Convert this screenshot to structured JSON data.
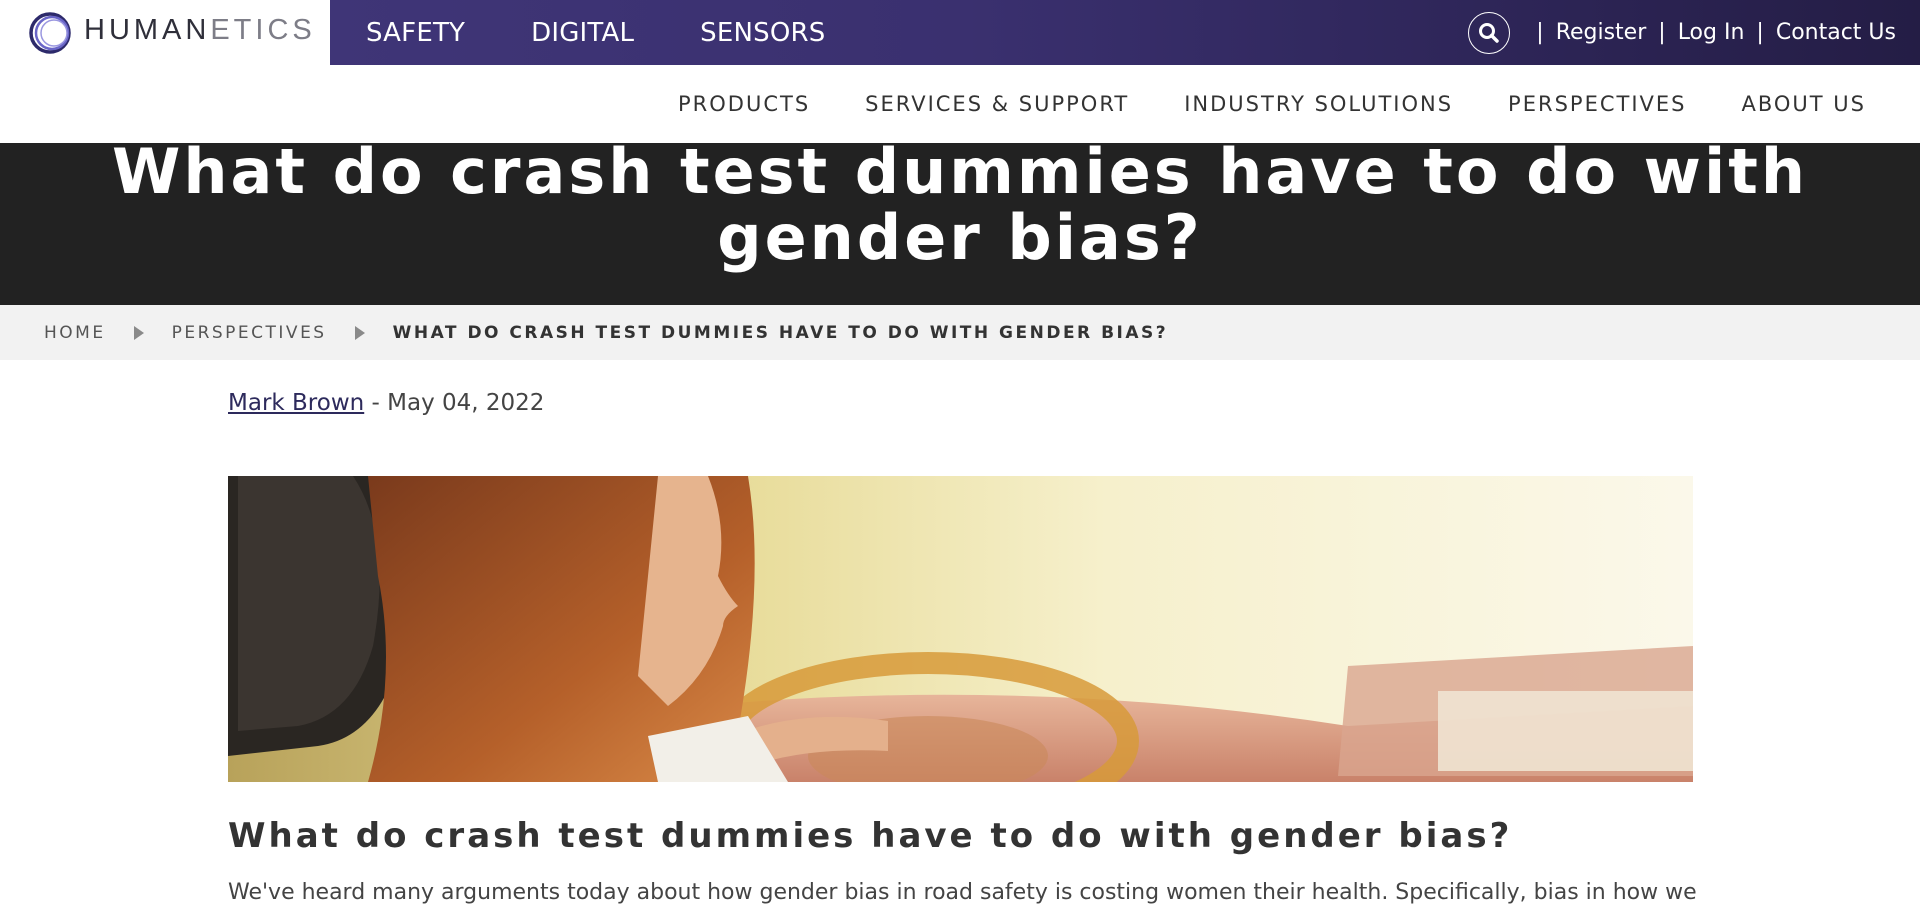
{
  "brand": {
    "logo_bold": "HUMAN",
    "logo_light": "ETICS",
    "nav": [
      "SAFETY",
      "DIGITAL",
      "SENSORS"
    ],
    "band_color": "#3f3577"
  },
  "utility": {
    "search_icon": "search-icon",
    "register": "Register",
    "login": "Log In",
    "contact": "Contact Us",
    "separator": "|"
  },
  "mainnav": {
    "items": [
      "PRODUCTS",
      "SERVICES & SUPPORT",
      "INDUSTRY SOLUTIONS",
      "PERSPECTIVES",
      "ABOUT US"
    ]
  },
  "hero": {
    "title": "What do crash test dummies have to do with gender bias?",
    "background": "#222222"
  },
  "breadcrumb": {
    "home": "HOME",
    "section": "PERSPECTIVES",
    "current": "WHAT DO CRASH TEST DUMMIES HAVE TO DO WITH GENDER BIAS?"
  },
  "article": {
    "author": "Mark Brown",
    "date_sep": " - ",
    "date": "May 04, 2022",
    "heading": "What do crash test dummies have to do with gender bias?",
    "intro": "We've heard many arguments today about how gender bias in road safety is costing women their health. Specifically, bias in how we test"
  }
}
